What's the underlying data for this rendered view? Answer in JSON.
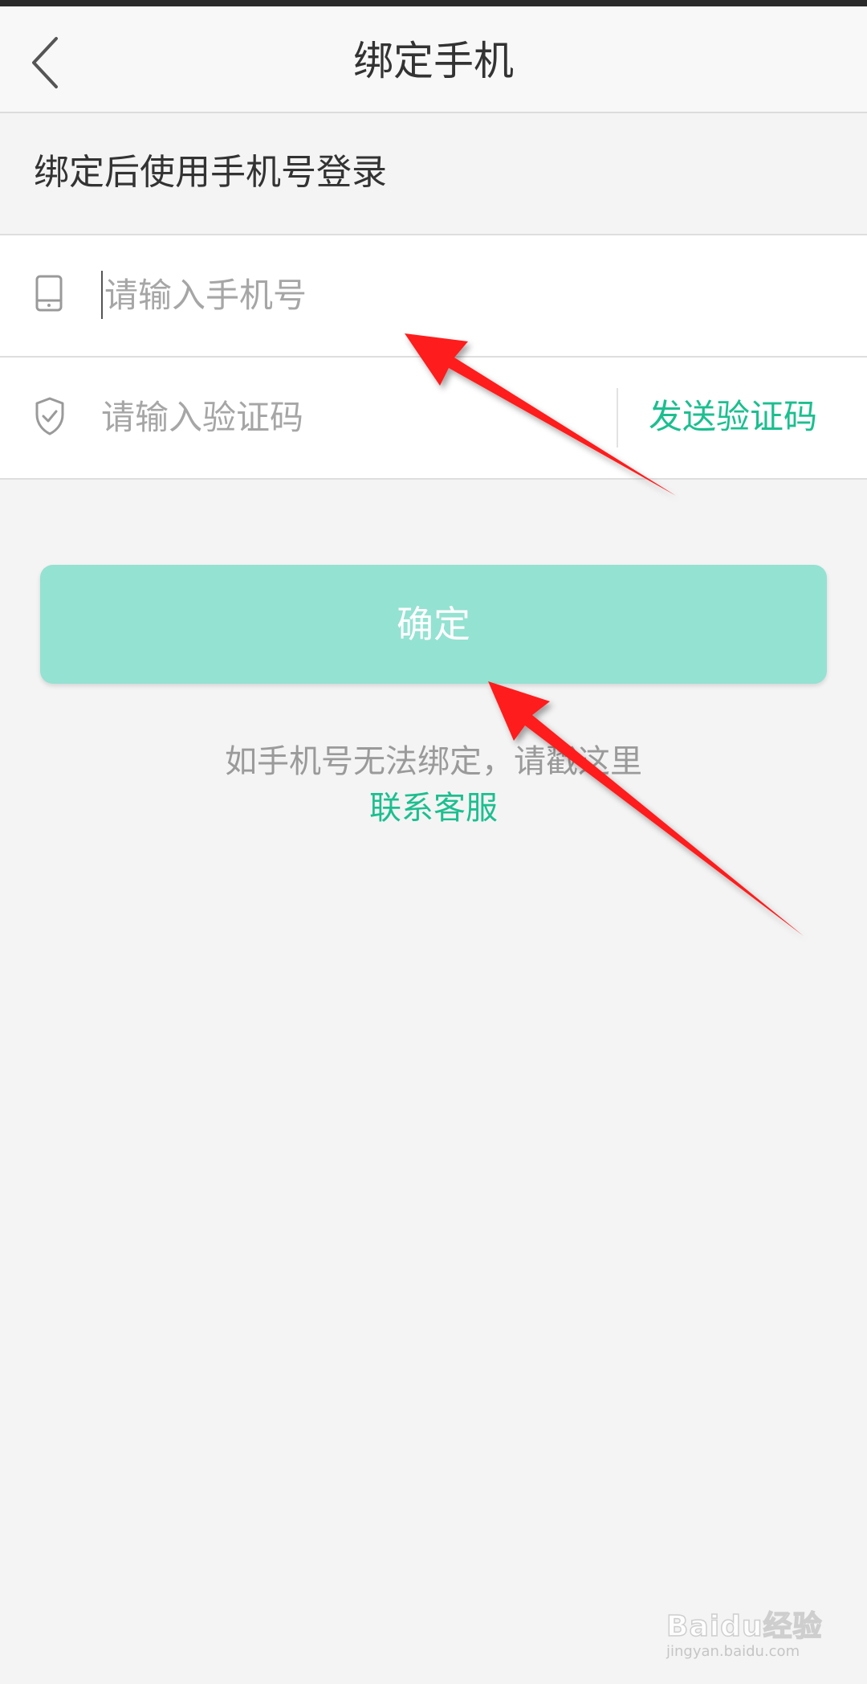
{
  "header": {
    "back_icon": "chevron-left-icon",
    "title": "绑定手机"
  },
  "subtitle": "绑定后使用手机号登录",
  "form": {
    "phone": {
      "icon": "phone-icon",
      "placeholder": "请输入手机号",
      "value": ""
    },
    "code": {
      "icon": "shield-check-icon",
      "placeholder": "请输入验证码",
      "value": "",
      "send_label": "发送验证码"
    }
  },
  "confirm_label": "确定",
  "help": {
    "text": "如手机号无法绑定，请戳这里",
    "link": "联系客服"
  },
  "annotations": {
    "arrow_color": "#ff1a1a",
    "arrow_count": 2
  },
  "watermark": {
    "main": "Baidu经验",
    "sub": "jingyan.baidu.com"
  },
  "colors": {
    "accent_green": "#1cbf8f",
    "button_fill": "#94e2d2",
    "background": "#f4f4f4"
  }
}
